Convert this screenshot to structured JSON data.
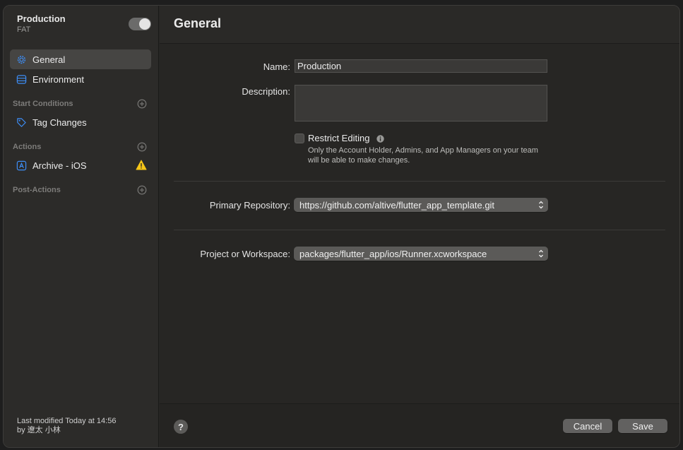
{
  "sidebar": {
    "workflow_name": "Production",
    "workflow_subtitle": "FAT",
    "items": [
      {
        "label": "General",
        "icon": "gear-icon"
      },
      {
        "label": "Environment",
        "icon": "environment-icon"
      }
    ],
    "start_conditions": {
      "header": "Start Conditions",
      "items": [
        {
          "label": "Tag Changes",
          "icon": "tag-icon"
        }
      ]
    },
    "actions": {
      "header": "Actions",
      "items": [
        {
          "label": "Archive - iOS",
          "icon": "archive-icon",
          "warning_icon": "warning-icon"
        }
      ]
    },
    "post_actions": {
      "header": "Post-Actions"
    },
    "last_modified_line1": "Last modified Today at 14:56",
    "last_modified_line2": "by 遼太 小林"
  },
  "main": {
    "title": "General",
    "name_label": "Name:",
    "name_value": "Production",
    "description_label": "Description:",
    "description_value": "",
    "restrict_label": "Restrict Editing",
    "restrict_help": "Only the Account Holder, Admins, and App Managers on your team will be able to make changes.",
    "primary_repo_label": "Primary Repository:",
    "primary_repo_value": "https://github.com/altive/flutter_app_template.git",
    "workspace_label": "Project or Workspace:",
    "workspace_value": "packages/flutter_app/ios/Runner.xcworkspace"
  },
  "footer": {
    "help_label": "?",
    "cancel_label": "Cancel",
    "save_label": "Save"
  },
  "colors": {
    "accent": "#3d8ef7",
    "warning": "#f5c518"
  }
}
